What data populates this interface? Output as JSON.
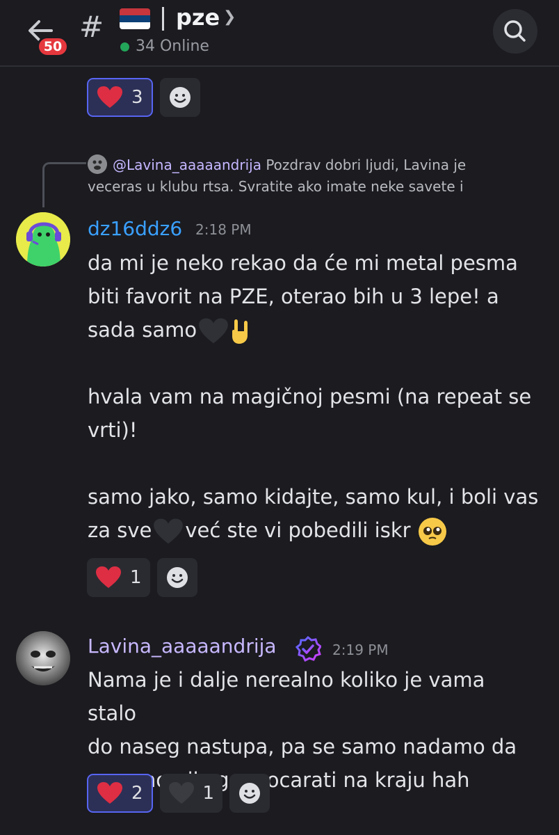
{
  "header": {
    "unread_badge": "50",
    "hash_symbol": "#",
    "channel_name": "pze",
    "online_status": "34 Online",
    "flag_icon": "serbia-flag-icon"
  },
  "colors": {
    "background": "#1b1b20",
    "online": "#23a55a",
    "badge": "#e5383e",
    "username_dz": "#3aa0ff",
    "username_lavina": "#c8b8ff",
    "reaction_active_border": "#5865f2"
  },
  "top_reactions": [
    {
      "emoji": "red-heart",
      "count": "3",
      "active": true
    }
  ],
  "reply": {
    "mention": "@Lavina_aaaaandrija",
    "snippet_line1": "Pozdrav dobri ljudi, Lavina je",
    "snippet_line2": "veceras u klubu rtsa. Svratite ako imate neke savete i"
  },
  "messages": [
    {
      "username": "dz16ddz6",
      "time": "2:18 PM",
      "line1": "da mi je neko rekao da će mi metal pesma",
      "line2": "biti favorit na PZE, oterao bih u 3 lepe! a",
      "line3": "sada samo",
      "line4": "hvala vam na magičnoj pesmi (na repeat se",
      "line5": "vrti)!",
      "line6": "samo jako, samo kidajte, samo kul, i boli vas",
      "line7_a": "za sve",
      "line7_b": "već ste vi pobedili iskr",
      "reactions": [
        {
          "emoji": "red-heart",
          "count": "1",
          "active": false
        }
      ]
    },
    {
      "username": "Lavina_aaaaandrija",
      "verified": true,
      "time": "2:19 PM",
      "line1": "Nama je i dalje nerealno koliko je vama stalo",
      "line2": "do naseg nastupa, pa se samo nadamo da",
      "line3": "necemo nikog razocarati na kraju hah",
      "reactions": [
        {
          "emoji": "red-heart",
          "count": "2",
          "active": true
        },
        {
          "emoji": "black-heart",
          "count": "1",
          "active": false
        }
      ]
    }
  ]
}
